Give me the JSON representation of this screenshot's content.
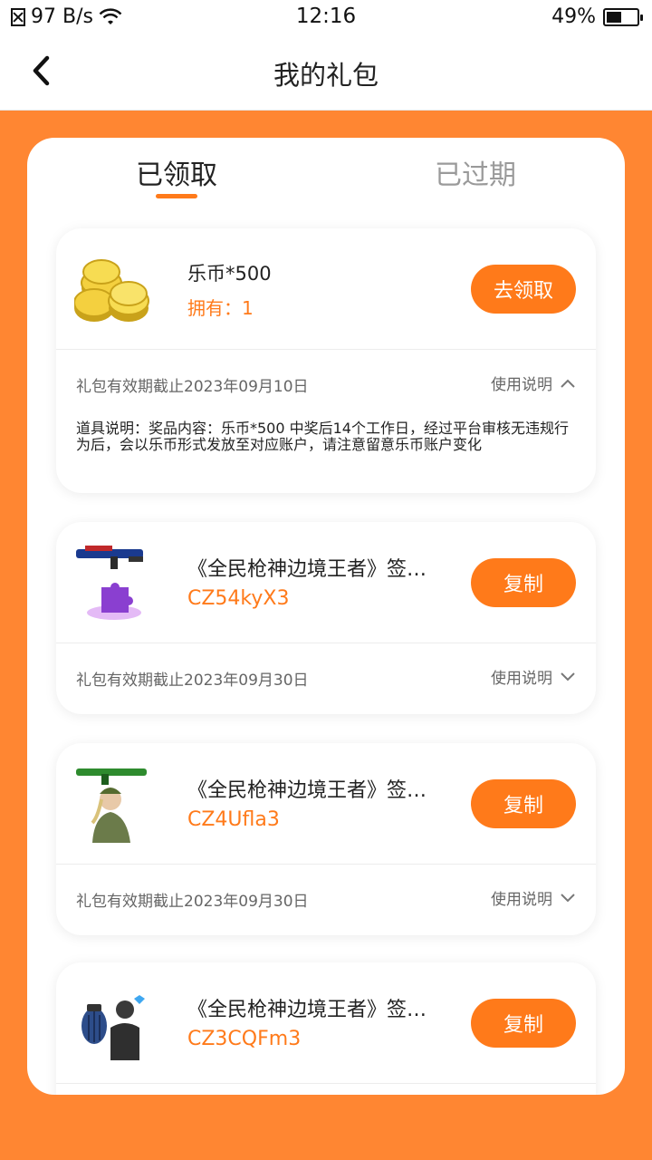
{
  "status_bar": {
    "speed": "97 B/s",
    "time": "12:16",
    "battery_percent": "49%",
    "battery_level": 0.49
  },
  "nav": {
    "title": "我的礼包"
  },
  "tabs": [
    {
      "label": "已领取",
      "active": true
    },
    {
      "label": "已过期",
      "active": false
    }
  ],
  "gifts": [
    {
      "icon": "coins-icon",
      "title": "乐币*500",
      "owned": "拥有：1",
      "button": "去领取",
      "expiry": "礼包有效期截止2023年09月10日",
      "usage_label": "使用说明",
      "expanded": true,
      "description": "道具说明：奖品内容：乐币*500 中奖后14个工作日，经过平台审核无违规行为后，会以乐币形式发放至对应账户，请注意留意乐币账户变化"
    },
    {
      "icon": "gun-puzzle-icon",
      "title": "《全民枪神边境王者》签…",
      "code": "CZ54kyX3",
      "button": "复制",
      "expiry": "礼包有效期截止2023年09月30日",
      "usage_label": "使用说明",
      "expanded": false
    },
    {
      "icon": "soldier-rifle-icon",
      "title": "《全民枪神边境王者》签…",
      "code": "CZ4Ufla3",
      "button": "复制",
      "expiry": "礼包有效期截止2023年09月30日",
      "usage_label": "使用说明",
      "expanded": false
    },
    {
      "icon": "grenade-vest-icon",
      "title": "《全民枪神边境王者》签…",
      "code": "CZ3CQFm3",
      "button": "复制",
      "expanded": false
    }
  ],
  "colors": {
    "accent": "#ff7a1a",
    "background": "#ff8632"
  }
}
